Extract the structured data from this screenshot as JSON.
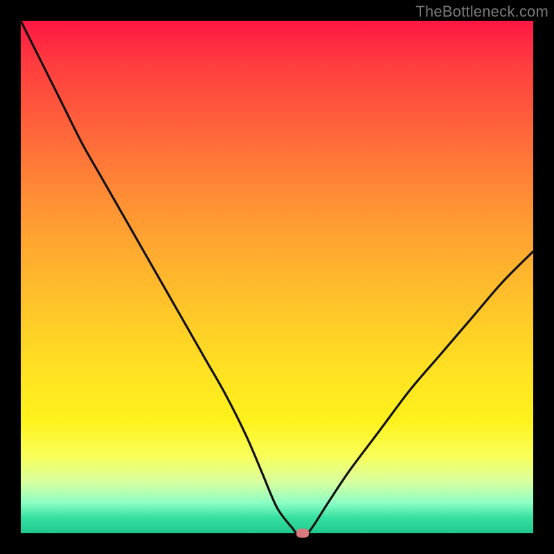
{
  "watermark": "TheBottleneck.com",
  "colors": {
    "frame_bg": "#000000",
    "gradient_top": "#ff1744",
    "gradient_bottom": "#1fc98c",
    "curve_stroke": "#111111",
    "marker_fill": "#d87a7e"
  },
  "chart_data": {
    "type": "line",
    "title": "",
    "xlabel": "",
    "ylabel": "",
    "xlim": [
      0,
      100
    ],
    "ylim": [
      0,
      100
    ],
    "grid": false,
    "legend": false,
    "series": [
      {
        "name": "bottleneck-curve",
        "x": [
          0,
          4,
          8,
          12,
          16,
          20,
          24,
          28,
          32,
          36,
          40,
          44,
          47,
          50,
          53,
          54,
          56,
          60,
          64,
          70,
          76,
          82,
          88,
          94,
          100
        ],
        "y": [
          100,
          92,
          84,
          76,
          69,
          62,
          55,
          48,
          41,
          34,
          27,
          19,
          12,
          5,
          1,
          0,
          0,
          6,
          12,
          20,
          28,
          35,
          42,
          49,
          55
        ]
      }
    ],
    "annotations": [
      {
        "name": "min-marker",
        "x": 55,
        "y": 0
      }
    ],
    "note": "y is bottleneck percentage (0 at bottom, 100 at top). Background gradient encodes the same 0–100 scale: green≈0, red≈100."
  }
}
